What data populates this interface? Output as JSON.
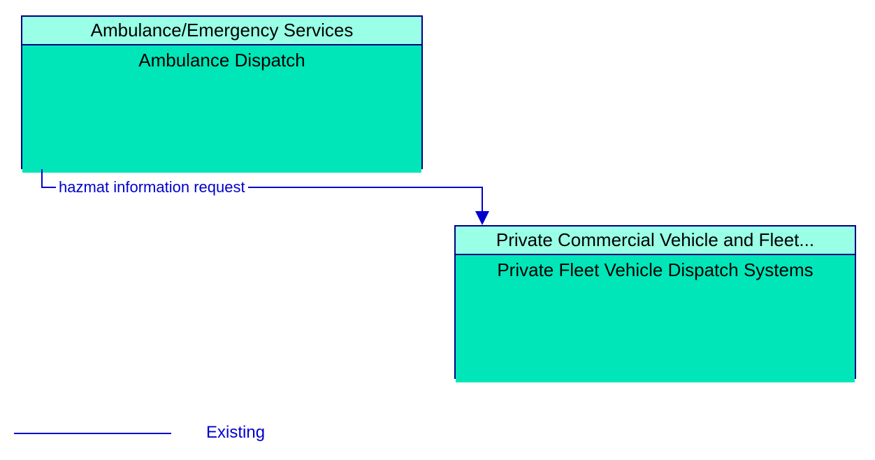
{
  "boxes": {
    "left": {
      "header": "Ambulance/Emergency Services",
      "body": "Ambulance Dispatch"
    },
    "right": {
      "header": "Private Commercial Vehicle and Fleet...",
      "body": "Private Fleet Vehicle Dispatch Systems"
    }
  },
  "flow": {
    "label": "hazmat information request"
  },
  "legend": {
    "label": "Existing"
  },
  "colors": {
    "border": "#000080",
    "header_bg": "#99ffe6",
    "body_bg": "#00e6b8",
    "link": "#0000cd"
  }
}
